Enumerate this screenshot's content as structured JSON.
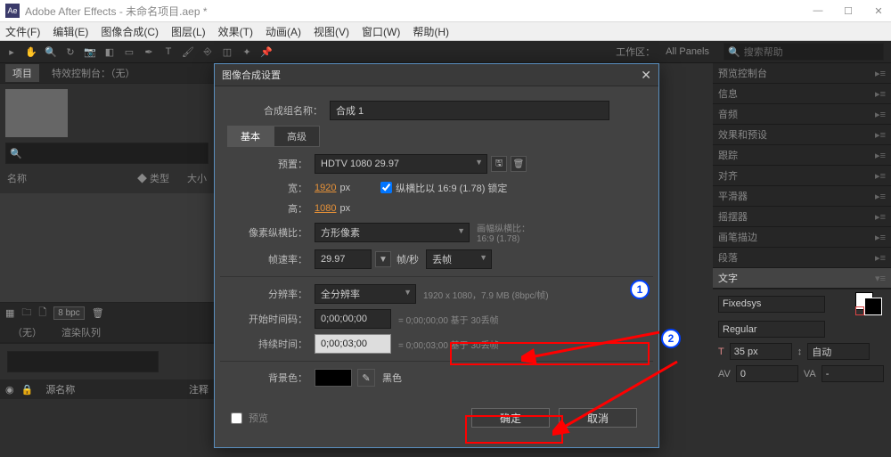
{
  "colors": {
    "accent": "#1a5fb4",
    "orange": "#e69138",
    "red": "#ff0000"
  },
  "window": {
    "app_icon": "Ae",
    "title": "Adobe After Effects - 未命名项目.aep *",
    "minimize": "—",
    "maximize": "☐",
    "close": "✕"
  },
  "menu": [
    "文件(F)",
    "编辑(E)",
    "图像合成(C)",
    "图层(L)",
    "效果(T)",
    "动画(A)",
    "视图(V)",
    "窗口(W)",
    "帮助(H)"
  ],
  "toolbar": {
    "workspace_label": "工作区：",
    "workspace_value": "All Panels",
    "help_placeholder": "搜索帮助"
  },
  "left": {
    "tabs": {
      "project": "项目",
      "effect_controls": "特效控制台：（无）"
    },
    "search_placeholder": "🔍",
    "footer": {
      "bpc": "8 bpc"
    },
    "lower_tabs": {
      "none": "（无）",
      "render_queue": "渲染队列"
    },
    "timeline": {
      "eye": "◉",
      "source_label": "源名称",
      "comment_label": "注释"
    },
    "ruler": {
      "sizes_label": "大小"
    }
  },
  "right": {
    "strips": [
      "预览控制台",
      "信息",
      "音频",
      "效果和预设",
      "跟踪",
      "对齐",
      "平滑器",
      "摇摆器",
      "画笔描边",
      "段落"
    ],
    "char": {
      "title": "文字",
      "font": "Fixedsys",
      "style": "Regular",
      "size_icon": "T",
      "size": "35 px",
      "leading_icon": "↕",
      "leading": "自动",
      "kern_icon": "AV",
      "kern": "0",
      "track_icon": "VA",
      "track": "- "
    }
  },
  "dialog": {
    "title": "图像合成设置",
    "close_glyph": "✕",
    "name_label": "合成组名称：",
    "name_value": "合成 1",
    "tab_basic": "基本",
    "tab_advanced": "高级",
    "preset_label": "预置：",
    "preset_value": "HDTV 1080 29.97",
    "width_label": "宽：",
    "width_value": "1920",
    "width_unit": "px",
    "height_label": "高：",
    "height_value": "1080",
    "height_unit": "px",
    "lock_aspect_label": "纵横比以 16:9 (1.78) 锁定",
    "par_label": "像素纵横比：",
    "par_value": "方形像素",
    "frame_aspect_label": "画幅纵横比：",
    "frame_aspect_value": "16:9 (1.78)",
    "fps_label": "帧速率：",
    "fps_value": "29.97",
    "fps_unit": "帧/秒",
    "fps_drop": "丢帧",
    "res_label": "分辨率：",
    "res_value": "全分辨率",
    "res_info": "1920 x 1080，7.9 MB (8bpc/帧)",
    "start_label": "开始时间码：",
    "start_value": "0;00;00;00",
    "start_info": "= 0;00;00;00 基于 30丢帧",
    "dur_label": "持续时间：",
    "dur_value": "0;00;03;00",
    "dur_info": "= 0;00;03;00 基于 30丢帧",
    "bg_label": "背景色：",
    "bg_name": "黑色",
    "preview_chk": "预览",
    "ok": "确定",
    "cancel": "取消",
    "trash_glyph": "🗑",
    "save_preset_glyph": "🖫",
    "eyedrop_glyph": "✎"
  },
  "annot": {
    "n1": "1",
    "n2": "2"
  }
}
